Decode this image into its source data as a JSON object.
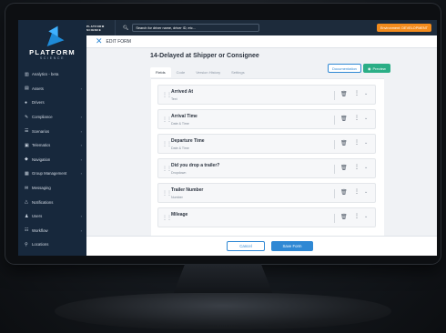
{
  "app": {
    "logo_text": "PLATFORM",
    "logo_subtext": "SCIENCE",
    "topbar_logo_text": "PLATFORM SCIENCE"
  },
  "search": {
    "placeholder": "Search for driver name, driver ID, etc..."
  },
  "environment_badge": "Environment: DEVELOPMENT",
  "sidebar": {
    "items": [
      {
        "label": "Analytics - beta",
        "icon": "bar-chart-icon",
        "has_chevron": false
      },
      {
        "label": "Assets",
        "icon": "truck-icon",
        "has_chevron": true
      },
      {
        "label": "Drivers",
        "icon": "user-icon",
        "has_chevron": false
      },
      {
        "label": "Compliance",
        "icon": "wrench-icon",
        "has_chevron": true
      },
      {
        "label": "Scenarios",
        "icon": "list-icon",
        "has_chevron": true
      },
      {
        "label": "Telematics",
        "icon": "chip-icon",
        "has_chevron": true
      },
      {
        "label": "Navigation",
        "icon": "compass-icon",
        "has_chevron": true
      },
      {
        "label": "Group Management",
        "icon": "grid-icon",
        "has_chevron": true
      },
      {
        "label": "Messaging",
        "icon": "chat-icon",
        "has_chevron": false
      },
      {
        "label": "Notifications",
        "icon": "bell-icon",
        "has_chevron": false
      },
      {
        "label": "Users",
        "icon": "users-icon",
        "has_chevron": true
      },
      {
        "label": "Workflow",
        "icon": "workflow-icon",
        "has_chevron": true
      },
      {
        "label": "Locations",
        "icon": "pin-icon",
        "has_chevron": false
      }
    ]
  },
  "editbar": {
    "title": "EDIT FORM"
  },
  "form": {
    "title": "14-Delayed at Shipper or Consignee",
    "tabs": [
      "Fields",
      "Code",
      "Version History",
      "Settings"
    ],
    "active_tab": "Fields",
    "documentation_label": "Documentation",
    "preview_label": "Preview",
    "fields": [
      {
        "label": "Arrived At",
        "type": "Text"
      },
      {
        "label": "Arrival Time",
        "type": "Date & Time"
      },
      {
        "label": "Departure Time",
        "type": "Date & Time"
      },
      {
        "label": "Did you drop a trailer?",
        "type": "Dropdown"
      },
      {
        "label": "Trailer Number",
        "type": "Number"
      },
      {
        "label": "Mileage",
        "type": ""
      }
    ]
  },
  "footer": {
    "cancel_label": "Cancel",
    "save_label": "Save Form"
  }
}
